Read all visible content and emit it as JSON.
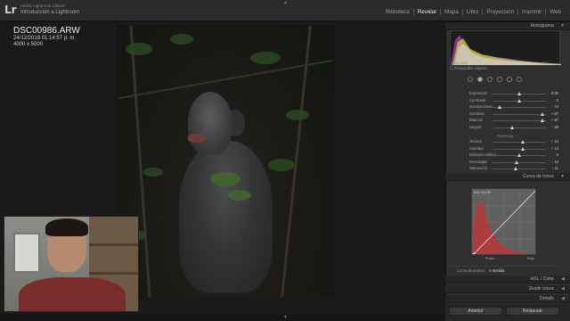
{
  "app": {
    "logo": "Lr",
    "catalog": "Adobe Lightroom Classic",
    "title": "Introducción a Lightroom",
    "modules": [
      "Biblioteca",
      "Revelar",
      "Mapa",
      "Libro",
      "Proyección",
      "Imprimir",
      "Web"
    ],
    "active_module": "Revelar"
  },
  "photo_info": {
    "filename": "DSC00986.ARW",
    "datetime": "24/12/2018 01:14:57 p. m.",
    "dimensions": "4000 x 5000"
  },
  "panels": {
    "histogram": "Histograma",
    "histogram_check": "Fotografía original",
    "tone_curve": "Curva de tonos",
    "hsl": "HSL / Color",
    "split_toning": "Dividir tonos",
    "detail": "Detalle"
  },
  "basic_sliders": [
    {
      "label": "Exposición",
      "value": "0.00",
      "pos": 0.5
    },
    {
      "label": "Contraste",
      "value": "0",
      "pos": 0.5
    },
    {
      "label": "Iluminaciones",
      "value": "- 74",
      "pos": 0.13
    },
    {
      "label": "Sombras",
      "value": "+ 87",
      "pos": 0.93
    },
    {
      "label": "Blancos",
      "value": "+ 87",
      "pos": 0.93
    },
    {
      "label": "Negros",
      "value": "- 26",
      "pos": 0.37
    }
  ],
  "presence_label": "Presencia",
  "presence_sliders": [
    {
      "label": "Textura",
      "value": "+ 12",
      "pos": 0.56
    },
    {
      "label": "Claridad",
      "value": "+ 13",
      "pos": 0.56
    },
    {
      "label": "Eliminar neblina",
      "value": "0",
      "pos": 0.5
    },
    {
      "label": "Intensidad",
      "value": "- 10",
      "pos": 0.45
    },
    {
      "label": "Saturación",
      "value": "- 11",
      "pos": 0.44
    }
  ],
  "tone_curve": {
    "readout": "5.5 / 8.8 %",
    "left_label": "Punto",
    "right_label": "Rojo",
    "channel_label": "Curva de puntos :",
    "channel_value": "A medida",
    "histogram_color": "#b33a3a"
  },
  "buttons": {
    "previous": "Anterior",
    "reset": "Restaurar"
  },
  "histogram_labels": {
    "left": "ISO 1600",
    "right": "f/4,0"
  }
}
